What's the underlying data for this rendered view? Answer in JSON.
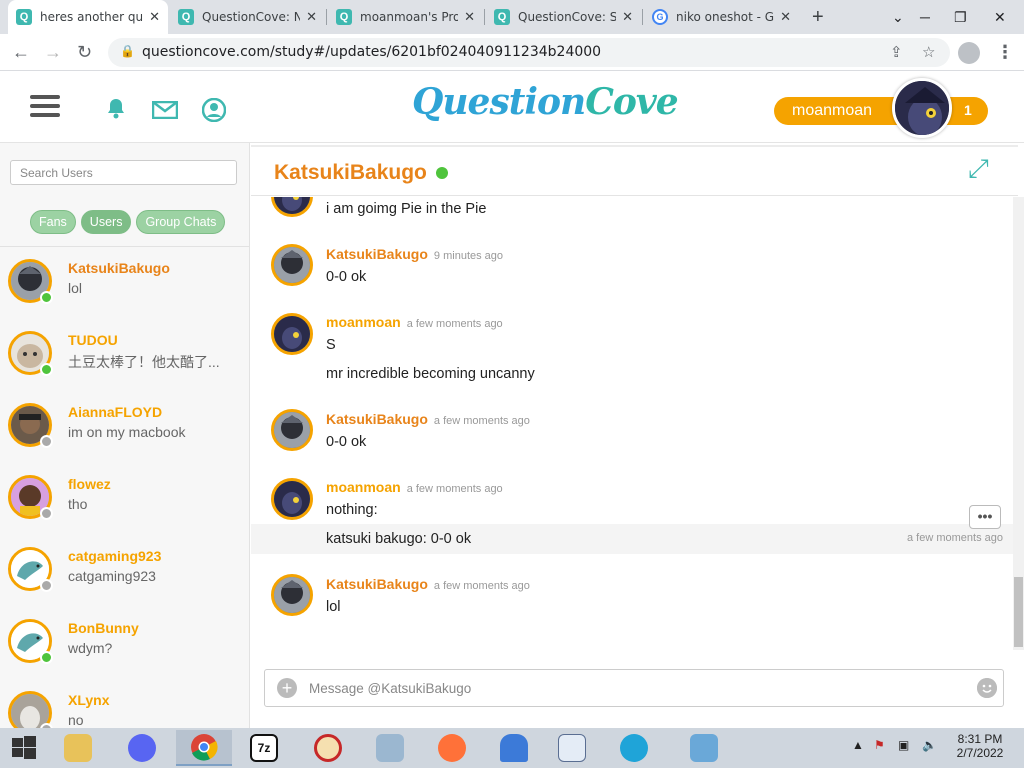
{
  "browser": {
    "tabs": [
      {
        "title": "heres another qu",
        "favicon": "questioncove-favicon",
        "active": true
      },
      {
        "title": "QuestionCove: No",
        "favicon": "questioncove-favicon",
        "active": false
      },
      {
        "title": "moanmoan's Prof",
        "favicon": "questioncove-favicon",
        "active": false
      },
      {
        "title": "QuestionCove: Se",
        "favicon": "questioncove-favicon",
        "active": false
      },
      {
        "title": "niko oneshot - Go",
        "favicon": "google-favicon",
        "active": false
      }
    ],
    "new_tab": "+",
    "url": "questioncove.com/study#/updates/6201bf024040911234b24000"
  },
  "header": {
    "logo_left": "Question",
    "logo_right": "Cove",
    "username": "moanmoan",
    "notification_count": "1"
  },
  "sidebar": {
    "search_placeholder": "Search Users",
    "filters": [
      "Fans",
      "Users",
      "Group Chats"
    ],
    "contacts": [
      {
        "name": "KatsukiBakugo",
        "last": "lol",
        "online": true,
        "name_color": "#e8841a"
      },
      {
        "name": "TUDOU",
        "last": "土豆太棒了！他太酷了...",
        "online": true,
        "name_color": "#f5a300"
      },
      {
        "name": "AiannaFLOYD",
        "last": "im on my macbook",
        "online": false,
        "name_color": "#f5a300"
      },
      {
        "name": "flowez",
        "last": "tho",
        "online": false,
        "name_color": "#f5a300"
      },
      {
        "name": "catgaming923",
        "last": "catgaming923",
        "online": false,
        "name_color": "#f5a300"
      },
      {
        "name": "BonBunny",
        "last": "wdym?",
        "online": true,
        "name_color": "#f5a300"
      },
      {
        "name": "XLynx",
        "last": "no",
        "online": false,
        "name_color": "#f5a300"
      }
    ]
  },
  "chat": {
    "title": "KatsukiBakugo",
    "messages": [
      {
        "author": "",
        "time": "",
        "lines": [
          "i am goimg Pie in the Pie"
        ]
      },
      {
        "author": "KatsukiBakugo",
        "time": "9 minutes ago",
        "lines": [
          "0-0 ok"
        ]
      },
      {
        "author": "moanmoan",
        "time": "a few moments ago",
        "lines": [
          "S",
          "mr incredible becoming uncanny"
        ]
      },
      {
        "author": "KatsukiBakugo",
        "time": "a few moments ago",
        "lines": [
          "0-0 ok"
        ]
      },
      {
        "author": "moanmoan",
        "time": "a few moments ago",
        "lines": [
          "nothing:",
          "katsuki bakugo: 0-0 ok"
        ]
      },
      {
        "author": "KatsukiBakugo",
        "time": "a few moments ago",
        "lines": [
          "lol"
        ]
      }
    ],
    "hover_time": "a few moments ago",
    "more_label": "•••",
    "composer_placeholder": "Message @KatsukiBakugo"
  },
  "taskbar": {
    "clock_time": "8:31 PM",
    "clock_date": "2/7/2022",
    "tray_up": "▲"
  },
  "colors": {
    "accent_teal": "#3fb8b0",
    "orange": "#e8841a",
    "gold": "#f5a300",
    "online_green": "#4fc43c"
  }
}
